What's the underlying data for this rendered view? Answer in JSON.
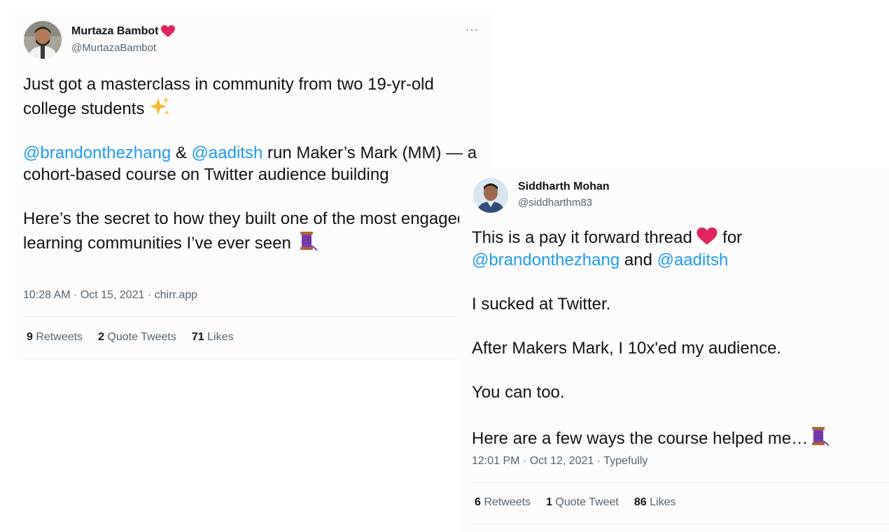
{
  "tweets": [
    {
      "author_name": "Murtaza Bambot",
      "author_badge_icon": "red-heart-icon",
      "handle": "@MurtazaBambot",
      "more_label": "···",
      "body": {
        "line1": "Just got a masterclass in community from two 19-yr-old college students",
        "sparkle_icon": "sparkles-icon",
        "mention1": "@brandonthezhang",
        "amp": " & ",
        "mention2": "@aaditsh",
        "line2_rest": " run Maker’s Mark (MM) — a cohort-based course on Twitter audience building",
        "line3": "Here’s the secret to how they built one of the most engaged learning communities I’ve ever seen",
        "thread_icon": "thread-spool-icon"
      },
      "meta": "10:28 AM · Oct 15, 2021 · chirr.app",
      "stats": {
        "retweets_count": "9",
        "retweets_label": "Retweets",
        "quotes_count": "2",
        "quotes_label": "Quote Tweets",
        "likes_count": "71",
        "likes_label": "Likes"
      }
    },
    {
      "author_name": "Siddharth Mohan",
      "handle": "@siddharthm83",
      "body": {
        "line1a": "This is a pay it forward thread",
        "heart_icon": "red-heart-icon",
        "line1b": " for",
        "mention1": "@brandonthezhang",
        "and": " and ",
        "mention2": "@aaditsh",
        "line2": "I sucked at Twitter.",
        "line3": "After Makers Mark, I 10x'ed my audience.",
        "line4": "You can too.",
        "line5": "Here are a few ways the course helped me…",
        "thread_icon": "thread-spool-icon"
      },
      "meta": "12:01 PM · Oct 12, 2021 · Typefully",
      "stats": {
        "retweets_count": "6",
        "retweets_label": "Retweets",
        "quotes_count": "1",
        "quotes_label": "Quote Tweet",
        "likes_count": "86",
        "likes_label": "Likes"
      }
    }
  ],
  "colors": {
    "mention": "#1d9bf0",
    "text": "#0f1419",
    "secondary": "#536471",
    "heart": "#e0245e"
  }
}
